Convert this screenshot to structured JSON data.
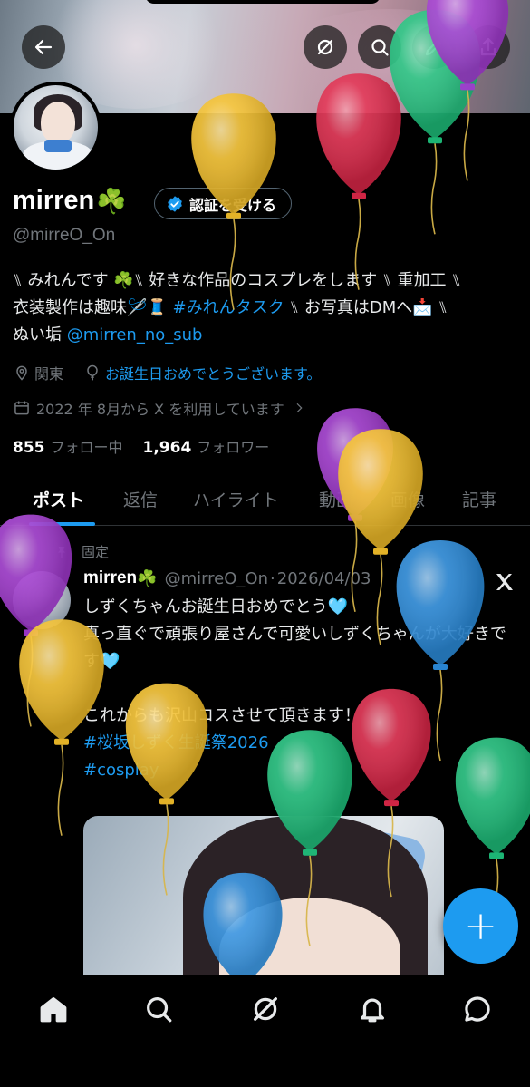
{
  "profile": {
    "display_name": "mirren",
    "name_emoji": "☘️",
    "verify_label": "認証を受ける",
    "handle": "@mirreO_On",
    "bio": {
      "line1": "⑊ みれんです ☘️⑊ 好きな作品のコスプレをします ⑊ 重加工 ⑊",
      "line2_pre": "衣装製作は趣味🪡🧵 ",
      "line2_tag": "#みれんタスク",
      "line2_post": " ⑊ お写真はDMへ📩 ⑊",
      "line3_pre": "ぬい垢 ",
      "line3_link": "@mirren_no_sub"
    },
    "location": "関東",
    "birthday": "お誕生日おめでとうございます。",
    "joined": "2022 年 8月から X を利用しています",
    "following_count": "855",
    "following_label": "フォロー中",
    "followers_count": "1,964",
    "followers_label": "フォロワー"
  },
  "tabs": [
    {
      "label": "ポスト"
    },
    {
      "label": "返信"
    },
    {
      "label": "ハイライト"
    },
    {
      "label": "動画"
    },
    {
      "label": "画像"
    },
    {
      "label": "記事"
    }
  ],
  "post": {
    "pinned_label": "固定",
    "author_name": "mirren",
    "author_emoji": "☘️",
    "author_handle": "@mirreO_On",
    "separator": "·",
    "date": "2026/04/03",
    "text_main": "しずくちゃんお誕生日おめでとう🩵\n真っ直ぐで頑張り屋さんで可愛いしずくちゃんが大好きです🩵\n\nこれからも沢山コスさせて頂きます！\n",
    "tag1": " #桜坂しずく生誕祭2026",
    "tag2": "#cosplay"
  },
  "fab": {
    "label": "+"
  },
  "colors": {
    "accent": "#1d9bf0",
    "background": "#000000",
    "text": "#e7e9ea",
    "secondary": "#71767b",
    "balloon_yellow": "#f5c02a",
    "balloon_red": "#e0284a",
    "balloon_green": "#1fc27d",
    "balloon_purple": "#a33ad1",
    "balloon_blue": "#2d8fe0"
  },
  "icons": {
    "back": "arrow-left-icon",
    "grok": "grok-icon",
    "search": "search-icon",
    "edit": "pencil-icon",
    "share": "share-icon",
    "verified": "verified-badge-icon",
    "location": "location-pin-icon",
    "birthday": "balloon-icon",
    "calendar": "calendar-icon",
    "pin": "pin-icon",
    "x_logo": "x-logo-icon",
    "home": "home-icon",
    "explore": "search-icon",
    "grok_nav": "grok-icon",
    "notifications": "bell-icon",
    "messages": "message-icon"
  }
}
